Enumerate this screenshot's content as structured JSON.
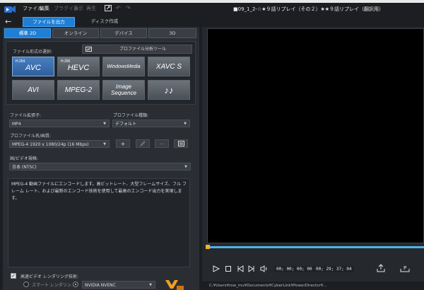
{
  "titlebar": {
    "menus": [
      "ファイル",
      "編集",
      "プラグイン",
      "表示",
      "再生"
    ],
    "project_title": "■09_1_2-☆★９話リプレイ（その２）★★９話リプレイ（翻訳用）"
  },
  "top_tabs": {
    "output": "ファイルを出力",
    "disc": "ディスク作成"
  },
  "format_tabs": [
    "標準 2D",
    "オンライン",
    "デバイス",
    "3D"
  ],
  "file_format": {
    "label": "ファイル形式の選択:",
    "profile_tool": "プロファイル分析ツール",
    "buttons": [
      {
        "label": "AVC",
        "sub": "H.264",
        "selected": true
      },
      {
        "label": "HEVC",
        "sub": "H.265",
        "selected": false
      },
      {
        "label": "WindowsMedia",
        "sub": "",
        "selected": false
      },
      {
        "label": "XAVC S",
        "sub": "",
        "selected": false
      },
      {
        "label": "AVI",
        "sub": "",
        "selected": false
      },
      {
        "label": "MPEG-2",
        "sub": "",
        "selected": false
      },
      {
        "label": "Image Sequence",
        "sub": "",
        "selected": false
      },
      {
        "label": "♪♪",
        "sub": "",
        "selected": false
      }
    ]
  },
  "settings": {
    "ext_label": "ファイル拡張子:",
    "ext_value": "MP4",
    "quality_label": "プロファイル種類:",
    "quality_value": "デフォルト",
    "profile_label": "プロファイル名/画質:",
    "profile_value": "MPEG-4 1920 x 1080/24p (16 Mbps)",
    "region_label": "国/ビデオ規格:",
    "region_value": "日本 (NTSC)"
  },
  "description": "MPEG-4 動画ファイルにエンコードします。高ビットレート、大型フレームサイズ、フル フレーム レート、および最新のエンコード技術を使用して最高のエンコード出力を実現します。",
  "bottom_options": {
    "fast_render_label": "高速ビデオ レンダリング技術:",
    "smart_render": "スマート レンダリン...",
    "encoder": "NVIDIA NVENC"
  },
  "player": {
    "timecode_current": "00; 00; 00; 00",
    "timecode_total": "00; 29; 37; 04"
  },
  "path_text": "C:¥Users¥row_mu¥Documents¥CyberLink¥PowerDirector¥..."
}
